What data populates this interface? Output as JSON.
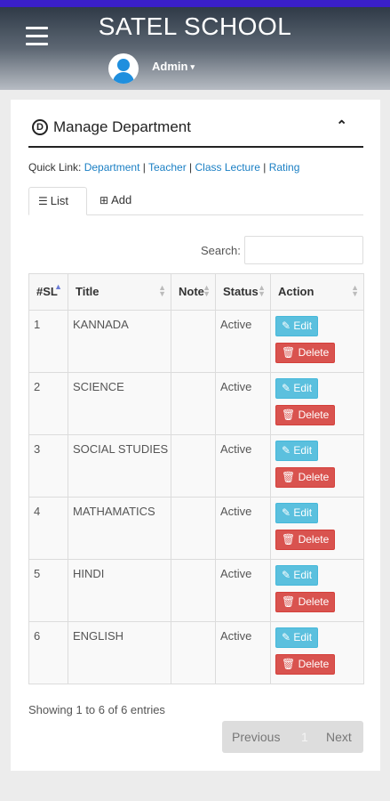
{
  "header": {
    "app_title": "SATEL SCHOOL",
    "user_name": "Admin",
    "caret": "⌄"
  },
  "panel": {
    "title": "Manage Department",
    "icon_glyph": "D"
  },
  "quick_links": {
    "label": "Quick Link:",
    "items": [
      "Department",
      "Teacher",
      "Class Lecture",
      "Rating"
    ]
  },
  "tabs": [
    {
      "label": "List"
    },
    {
      "label": "Add"
    }
  ],
  "search": {
    "label": "Search:",
    "value": ""
  },
  "table": {
    "columns": [
      "#SL",
      "Title",
      "Note",
      "Status",
      "Action"
    ],
    "rows": [
      {
        "sl": "1",
        "title": "KANNADA",
        "note": "",
        "status": "Active"
      },
      {
        "sl": "2",
        "title": "SCIENCE",
        "note": "",
        "status": "Active"
      },
      {
        "sl": "3",
        "title": "SOCIAL STUDIES",
        "note": "",
        "status": "Active"
      },
      {
        "sl": "4",
        "title": "MATHAMATICS",
        "note": "",
        "status": "Active"
      },
      {
        "sl": "5",
        "title": "HINDI",
        "note": "",
        "status": "Active"
      },
      {
        "sl": "6",
        "title": "ENGLISH",
        "note": "",
        "status": "Active"
      }
    ],
    "edit_label": "Edit",
    "delete_label": "Delete"
  },
  "footer": {
    "showing": "Showing 1 to 6 of 6 entries",
    "prev": "Previous",
    "page": "1",
    "next": "Next"
  }
}
